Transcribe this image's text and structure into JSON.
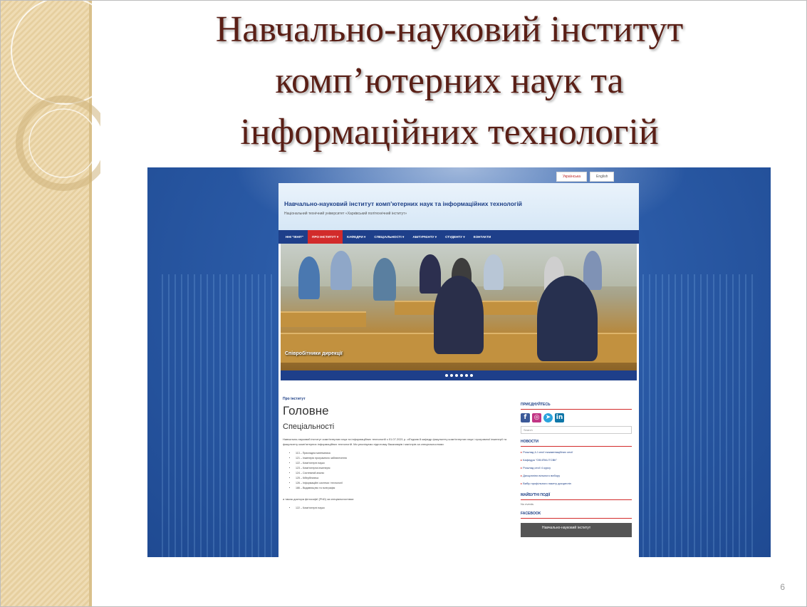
{
  "slide": {
    "title_lines": [
      "Навчально-науковий інститут",
      "комп’ютерних наук та",
      "інформаційних технологій"
    ],
    "page_number": "6"
  },
  "website": {
    "languages": [
      "Українська",
      "English"
    ],
    "header_title": "Навчально-науковий інститут комп’ютерних наук та інформаційних технологій",
    "header_subtitle": "Національний технічний університет «Харківський політехнічний інститут»",
    "nav": [
      {
        "label": "ННІ \"ІКНІТ\""
      },
      {
        "label": "ПРО ІНСТИТУТ ▾"
      },
      {
        "label": "КАФЕДРИ ▾"
      },
      {
        "label": "СПЕЦІАЛЬНОСТІ ▾"
      },
      {
        "label": "АБІТУРІЄНТУ ▾"
      },
      {
        "label": "СТУДЕНТУ ▾"
      },
      {
        "label": "КОНТАКТИ"
      }
    ],
    "slider_caption": "Співробітники дирекції",
    "breadcrumb": "Про інститут",
    "page_title": "Головне",
    "subheading": "Спеціальності",
    "intro_text": "Навчально-науковий інститут комп’ютерних наук та інформаційних технологій з 01.07.2021 р. об’єднав 8 кафедр факультету комп’ютерних наук і програмної інженерії та факультету комп’ютерних інформаційних технологій. Ми реалізуємо підготовку бакалаврів і магістрів за спеціальностями:",
    "specialties": [
      "113 – Прикладна математика",
      "121 – Інженерія програмного забезпечення",
      "122 – Комп’ютерні науки",
      "123 – Комп’ютерна інженерія",
      "124 – Системний аналіз",
      "125 – Кібербезпека",
      "126 – Інформаційні системи і технології",
      "186 – Видавництво та поліграфія"
    ],
    "phd_text": "а також доктора філософії (PhD) за спеціальностями:",
    "phd_specialties": [
      "122 – Комп’ютерні науки"
    ],
    "sidebar": {
      "join_title": "ПРИЄДНУЙТЕСЬ",
      "search_placeholder": "Search",
      "news_title": "НОВОСТИ",
      "news": [
        "Розклад 4-ї сесії екзаменаційних сесії",
        "Кафедра \"ОБЧПМ-ІТСВК\"",
        "Розклад сесії 4 курсу",
        "Дисципліни вільного вибору",
        "Вибір профільного пакету дисциплін"
      ],
      "events_title": "МАЙБУТНІ ПОДІЇ",
      "events_text": "No events",
      "facebook_title": "FACEBOOK",
      "facebook_page": "Навчально-науковий інститут"
    }
  },
  "colors": {
    "title": "#5a1f16",
    "nav": "#1e3f8a",
    "nav_active": "#d22b2b",
    "background_blue": "#2a5aa6"
  }
}
